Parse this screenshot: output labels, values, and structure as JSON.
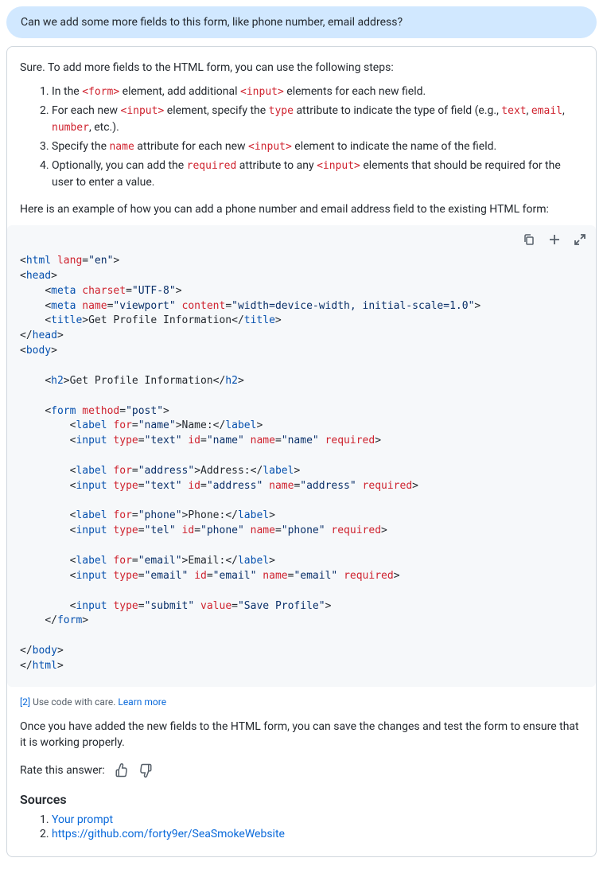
{
  "user_message": "Can we add some more fields to this form, like phone number, email address?",
  "intro": "Sure. To add more fields to the HTML form, you can use the following steps:",
  "steps": {
    "s1a": "In the ",
    "s1_code1": "<form>",
    "s1b": " element, add additional ",
    "s1_code2": "<input>",
    "s1c": " elements for each new field.",
    "s2a": "For each new ",
    "s2_code1": "<input>",
    "s2b": " element, specify the ",
    "s2_code2": "type",
    "s2c": " attribute to indicate the type of field (e.g., ",
    "s2_code3": "text",
    "s2d": ", ",
    "s2_code4": "email",
    "s2e": ", ",
    "s2_code5": "number",
    "s2f": ", etc.).",
    "s3a": "Specify the ",
    "s3_code1": "name",
    "s3b": " attribute for each new ",
    "s3_code2": "<input>",
    "s3c": " element to indicate the name of the field.",
    "s4a": "Optionally, you can add the ",
    "s4_code1": "required",
    "s4b": " attribute to any ",
    "s4_code2": "<input>",
    "s4c": " elements that should be required for the user to enter a value."
  },
  "example_intro": "Here is an example of how you can add a phone number and email address field to the existing HTML form:",
  "code": {
    "lang_attr": "lang",
    "lang_val": "\"en\"",
    "charset_attr": "charset",
    "charset_val": "\"UTF-8\"",
    "name_attr": "name",
    "viewport_val": "\"viewport\"",
    "content_attr": "content",
    "content_val": "\"width=device-width, initial-scale=1.0\"",
    "title_text": "Get Profile Information",
    "h2_text": "Get Profile Information",
    "method_attr": "method",
    "method_val": "\"post\"",
    "for_attr": "for",
    "type_attr": "type",
    "id_attr": "id",
    "required_attr": "required",
    "value_attr": "value",
    "name_val": "\"name\"",
    "name_label": "Name:",
    "text_val": "\"text\"",
    "address_val": "\"address\"",
    "address_label": "Address:",
    "phone_val": "\"phone\"",
    "phone_label": "Phone:",
    "tel_val": "\"tel\"",
    "email_val": "\"email\"",
    "email_label": "Email:",
    "submit_val": "\"submit\"",
    "save_val": "\"Save Profile\"",
    "tag_html": "html",
    "tag_head": "head",
    "tag_meta": "meta",
    "tag_title": "title",
    "tag_body": "body",
    "tag_h2": "h2",
    "tag_form": "form",
    "tag_label": "label",
    "tag_input": "input"
  },
  "care": {
    "ref": "[2]",
    "text": " Use code with care. ",
    "link": "Learn more"
  },
  "conclusion": "Once you have added the new fields to the HTML form, you can save the changes and test the form to ensure that it is working properly.",
  "rate_label": "Rate this answer:",
  "sources": {
    "heading": "Sources",
    "item1": "Your prompt",
    "item2": "https://github.com/forty9er/SeaSmokeWebsite"
  }
}
